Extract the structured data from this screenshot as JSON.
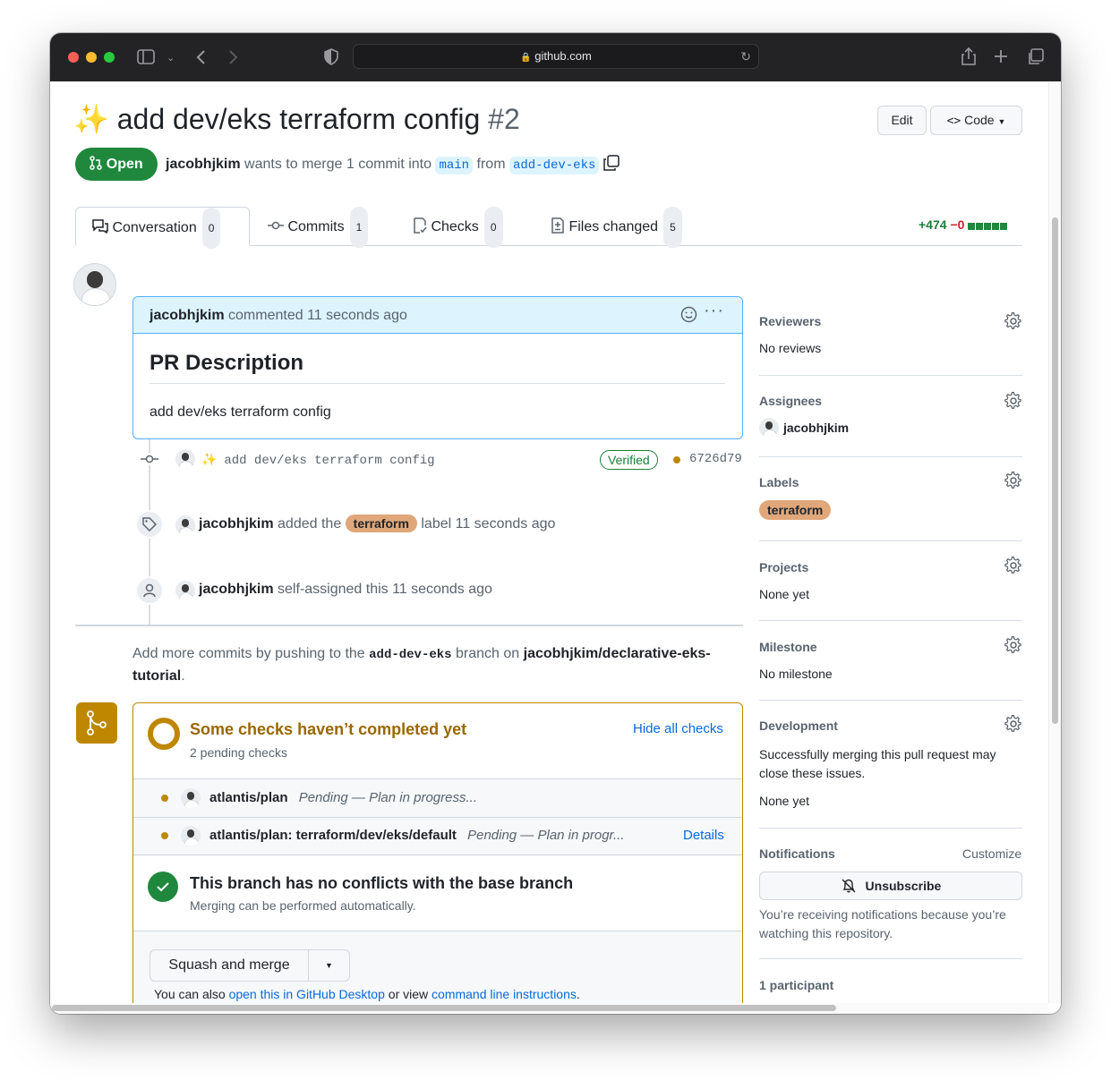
{
  "browser": {
    "url": "github.com",
    "colors": {
      "close": "#ff5f57",
      "minimize": "#febc2e",
      "maximize": "#28c840"
    }
  },
  "pr": {
    "emoji": "✨",
    "title": "add dev/eks terraform config",
    "number": "#2",
    "state": "Open",
    "author": "jacobhjkim",
    "merge_text": "wants to merge 1 commit into",
    "base_branch": "main",
    "from_text": "from",
    "head_branch": "add-dev-eks",
    "edit_label": "Edit",
    "code_label": "Code"
  },
  "tabs": [
    {
      "label": "Conversation",
      "count": "0",
      "icon": "comment-discussion-icon"
    },
    {
      "label": "Commits",
      "count": "1",
      "icon": "git-commit-icon"
    },
    {
      "label": "Checks",
      "count": "0",
      "icon": "checklist-icon"
    },
    {
      "label": "Files changed",
      "count": "5",
      "icon": "file-diff-icon"
    }
  ],
  "diffstat": {
    "additions": "+474",
    "deletions": "−0"
  },
  "comment": {
    "author": "jacobhjkim",
    "meta": "commented 11 seconds ago",
    "heading": "PR Description",
    "body": "add dev/eks terraform config"
  },
  "timeline": {
    "commit_emoji": "✨",
    "commit_message": "add dev/eks terraform config",
    "verified": "Verified",
    "sha": "6726d79",
    "label_event": {
      "actor": "jacobhjkim",
      "pre": "added the",
      "label": "terraform",
      "post": "label 11 seconds ago"
    },
    "assign_event": {
      "actor": "jacobhjkim",
      "text": "self-assigned this 11 seconds ago"
    }
  },
  "push_hint": {
    "pre": "Add more commits by pushing to the",
    "branch": "add-dev-eks",
    "mid": "branch on",
    "repo": "jacobhjkim/declarative-eks-tutorial",
    "end": "."
  },
  "checks": {
    "title": "Some checks haven’t completed yet",
    "subtitle": "2 pending checks",
    "toggle": "Hide all checks",
    "items": [
      {
        "name": "atlantis/plan",
        "status": "Pending — Plan in progress...",
        "details": ""
      },
      {
        "name": "atlantis/plan: terraform/dev/eks/default",
        "status": "Pending — Plan in progr...",
        "details": "Details"
      }
    ],
    "conflict_title": "This branch has no conflicts with the base branch",
    "conflict_sub": "Merging can be performed automatically.",
    "merge_button": "Squash and merge",
    "also_pre": "You can also",
    "desktop_link": "open this in GitHub Desktop",
    "also_mid": "or view",
    "cli_link": "command line instructions",
    "also_end": "."
  },
  "sidebar": {
    "reviewers": {
      "title": "Reviewers",
      "value": "No reviews"
    },
    "assignees": {
      "title": "Assignees",
      "value": "jacobhjkim"
    },
    "labels": {
      "title": "Labels",
      "value": "terraform"
    },
    "projects": {
      "title": "Projects",
      "value": "None yet"
    },
    "milestone": {
      "title": "Milestone",
      "value": "No milestone"
    },
    "development": {
      "title": "Development",
      "desc": "Successfully merging this pull request may close these issues.",
      "value": "None yet"
    },
    "notifications": {
      "title": "Notifications",
      "customize": "Customize",
      "button": "Unsubscribe",
      "desc": "You’re receiving notifications because you’re watching this repository."
    },
    "participants": {
      "title": "1 participant"
    }
  },
  "colors": {
    "open_green": "#1f883d",
    "label_terraform": "#e0a77a",
    "pending": "#bf8700",
    "link": "#0969da",
    "comment_header_bg": "#ddf4ff"
  }
}
